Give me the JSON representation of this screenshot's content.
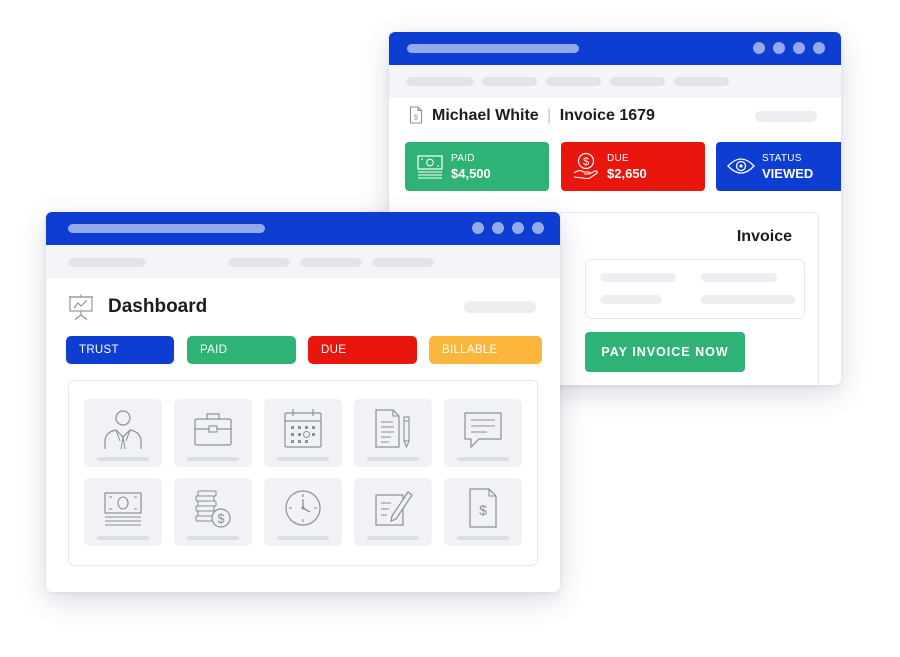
{
  "invoice_window": {
    "client_name": "Michael White",
    "separator": "|",
    "invoice_title": "Invoice 1679",
    "stats": [
      {
        "label": "PAID",
        "value": "$4,500",
        "color": "#2eb276",
        "icon": "cash-icon"
      },
      {
        "label": "DUE",
        "value": "$2,650",
        "color": "#e8160c",
        "icon": "money-hand-icon"
      },
      {
        "label": "STATUS",
        "value": "VIEWED",
        "color": "#0d3ed1",
        "icon": "eye-icon"
      }
    ],
    "panel_title": "Invoice",
    "pay_button": "PAY INVOICE NOW"
  },
  "dashboard_window": {
    "title": "Dashboard",
    "chips": [
      {
        "label": "TRUST",
        "color": "#0d3ed1"
      },
      {
        "label": "PAID",
        "color": "#2eb276"
      },
      {
        "label": "DUE",
        "color": "#e8160c"
      },
      {
        "label": "BILLABLE",
        "color": "#fbb73c"
      }
    ],
    "tiles": [
      {
        "icon": "user-icon"
      },
      {
        "icon": "briefcase-icon"
      },
      {
        "icon": "calendar-icon"
      },
      {
        "icon": "document-icon"
      },
      {
        "icon": "chat-icon"
      },
      {
        "icon": "money-icon"
      },
      {
        "icon": "coins-icon"
      },
      {
        "icon": "clock-icon"
      },
      {
        "icon": "edit-icon"
      },
      {
        "icon": "invoice-icon"
      }
    ]
  },
  "colors": {
    "brand_blue": "#0d3ed1",
    "success_green": "#2eb276",
    "danger_red": "#e8160c",
    "warning_yellow": "#fbb73c"
  }
}
